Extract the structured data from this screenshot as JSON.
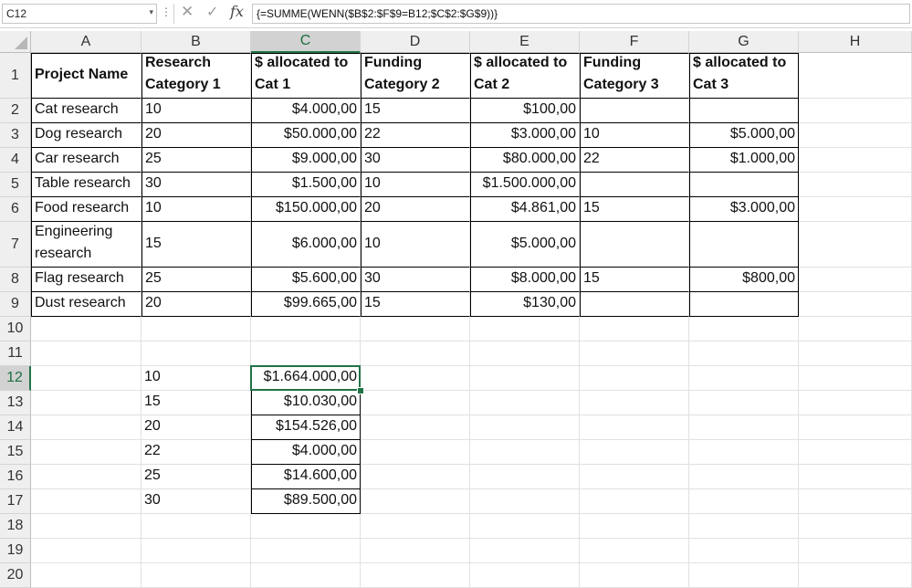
{
  "name_box": "C12",
  "formula": "{=SUMME(WENN($B$2:$F$9=B12;$C$2:$G$9))}",
  "columns": [
    "A",
    "B",
    "C",
    "D",
    "E",
    "F",
    "G",
    "H"
  ],
  "rows": [
    "1",
    "2",
    "3",
    "4",
    "5",
    "6",
    "7",
    "8",
    "9",
    "10",
    "11",
    "12",
    "13",
    "14",
    "15",
    "16",
    "17",
    "18",
    "19",
    "20"
  ],
  "table": {
    "headers": [
      "Project Name",
      "Research\nCategory 1",
      "$ allocated to\nCat 1",
      "Funding\nCategory 2",
      "$ allocated to\nCat 2",
      "Funding\nCategory 3",
      "$ allocated to\nCat 3"
    ],
    "body": [
      [
        "Cat research",
        "10",
        "$4.000,00",
        "15",
        "$100,00",
        "",
        ""
      ],
      [
        "Dog research",
        "20",
        "$50.000,00",
        "22",
        "$3.000,00",
        "10",
        "$5.000,00"
      ],
      [
        "Car research",
        "25",
        "$9.000,00",
        "30",
        "$80.000,00",
        "22",
        "$1.000,00"
      ],
      [
        "Table research",
        "30",
        "$1.500,00",
        "10",
        "$1.500.000,00",
        "",
        ""
      ],
      [
        "Food research",
        "10",
        "$150.000,00",
        "20",
        "$4.861,00",
        "15",
        "$3.000,00"
      ],
      [
        "Engineering\nresearch",
        "15",
        "$6.000,00",
        "10",
        "$5.000,00",
        "",
        ""
      ],
      [
        "Flag research",
        "25",
        "$5.600,00",
        "30",
        "$8.000,00",
        "15",
        "$800,00"
      ],
      [
        "Dust research",
        "20",
        "$99.665,00",
        "15",
        "$130,00",
        "",
        ""
      ]
    ]
  },
  "summary": [
    [
      "10",
      "$1.664.000,00"
    ],
    [
      "15",
      "$10.030,00"
    ],
    [
      "20",
      "$154.526,00"
    ],
    [
      "22",
      "$4.000,00"
    ],
    [
      "25",
      "$14.600,00"
    ],
    [
      "30",
      "$89.500,00"
    ]
  ],
  "icons": {
    "cancel": "✕",
    "enter": "✓",
    "function": "fx",
    "dropdown": "▾",
    "dots": "⋮"
  },
  "colors": {
    "selection": "#217346"
  }
}
